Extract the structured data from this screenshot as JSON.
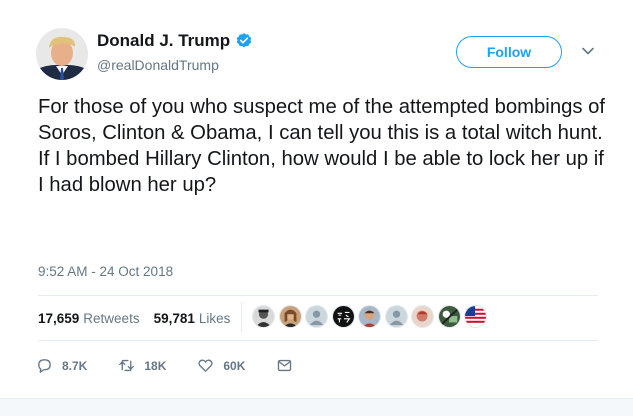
{
  "tweet": {
    "author": {
      "display_name": "Donald J. Trump",
      "handle": "@realDonaldTrump",
      "verified": true
    },
    "follow_label": "Follow",
    "text": "For those of you who suspect me of the attempted bombings of Soros, Clinton & Obama, I can tell you this is a total witch hunt. If I bombed Hillary Clinton, how would I be able to lock her up if I had blown her up?",
    "timestamp": "9:52 AM - 24 Oct 2018",
    "stats": {
      "retweets_count": "17,659",
      "retweets_label": "Retweets",
      "likes_count": "59,781",
      "likes_label": "Likes"
    },
    "likers": [
      {
        "kind": "photo",
        "bg": "#6e6e6e"
      },
      {
        "kind": "photo",
        "bg": "#a0704a"
      },
      {
        "kind": "default",
        "bg": "#ccd6dd"
      },
      {
        "kind": "text",
        "bg": "#111111"
      },
      {
        "kind": "photo",
        "bg": "#8a6a5c"
      },
      {
        "kind": "default",
        "bg": "#ccd6dd"
      },
      {
        "kind": "photo",
        "bg": "#b05a4a"
      },
      {
        "kind": "photo",
        "bg": "#4a6a4a"
      },
      {
        "kind": "flag",
        "bg": "#ffffff"
      }
    ],
    "actions": {
      "replies": "8.7K",
      "retweets": "18K",
      "likes": "60K"
    }
  },
  "colors": {
    "brand_blue": "#1da1f2",
    "muted": "#657786",
    "text": "#14171a",
    "divider": "#e6ecf0"
  }
}
